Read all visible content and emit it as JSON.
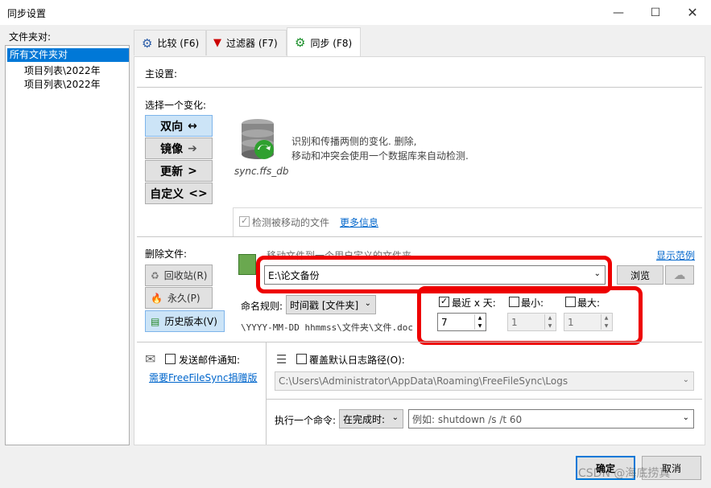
{
  "window": {
    "title": "同步设置"
  },
  "folder_pairs": {
    "header": "文件夹对:",
    "items": [
      "所有文件夹对",
      "项目列表\\2022年",
      "项目列表\\2022年"
    ]
  },
  "tabs": [
    {
      "label": "比较 (F6)"
    },
    {
      "label": "过滤器 (F7)"
    },
    {
      "label": "同步 (F8)"
    }
  ],
  "main": {
    "heading": "主设置:"
  },
  "variant": {
    "heading": "选择一个变化:",
    "options": [
      {
        "label": "双向",
        "arrow": "↔"
      },
      {
        "label": "镜像",
        "arrow": "➔"
      },
      {
        "label": "更新",
        "arrow": ">"
      },
      {
        "label": "自定义",
        "arrow": "<>"
      }
    ],
    "db_label": "sync.ffs_db",
    "description_line1": "识别和传播两侧的变化. 删除,",
    "description_line2": "移动和冲突会使用一个数据库来自动检测.",
    "detect_moved": "检测被移动的文件",
    "more_info": "更多信息"
  },
  "deletion": {
    "heading": "删除文件:",
    "options": [
      {
        "label": "回收站(R)"
      },
      {
        "label": "永久(P)"
      },
      {
        "label": "历史版本(V)"
      }
    ],
    "move_text": "移动文件到一个用户定义的文件夹",
    "show_examples": "显示范例",
    "path": "E:\\论文备份",
    "browse": "浏览",
    "naming_label": "命名规则:",
    "naming_value": "时间戳 [文件夹]",
    "pattern": "\\YYYY-MM-DD hhmmss\\文件夹\\文件.doc",
    "last_x_days": {
      "label": "最近 x 天:",
      "value": "7"
    },
    "min": {
      "label": "最小:",
      "value": "1"
    },
    "max": {
      "label": "最大:",
      "value": "1"
    }
  },
  "email": {
    "label": "发送邮件通知:",
    "donation_link": "需要FreeFileSync捐赠版"
  },
  "log": {
    "label": "覆盖默认日志路径(O):",
    "path": "C:\\Users\\Administrator\\AppData\\Roaming\\FreeFileSync\\Logs"
  },
  "command": {
    "label": "执行一个命令:",
    "when": "在完成时:",
    "placeholder": "例如: shutdown /s /t 60"
  },
  "footer": {
    "ok": "确定",
    "cancel": "取消",
    "watermark": "CSDN @海底捞真"
  },
  "colors": {
    "accent_red": "#e00000",
    "selected_blue": "#0078d7",
    "link": "#0066cc"
  }
}
